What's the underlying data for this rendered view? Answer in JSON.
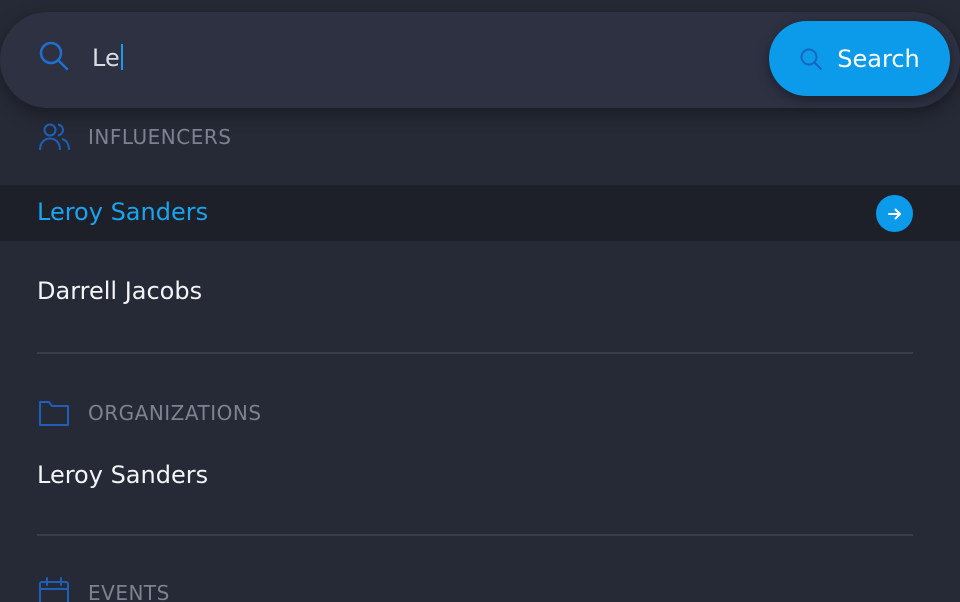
{
  "search": {
    "query": "Le",
    "button_label": "Search",
    "icon": "search-icon"
  },
  "sections": {
    "influencers": {
      "label": "INFLUENCERS",
      "icon": "users-icon",
      "items": [
        "Leroy Sanders",
        "Darrell Jacobs"
      ]
    },
    "organizations": {
      "label": "ORGANIZATIONS",
      "icon": "folder-icon",
      "items": [
        "Leroy Sanders"
      ]
    },
    "events": {
      "label": "EVENTS",
      "icon": "calendar-icon"
    }
  },
  "colors": {
    "background": "#262a36",
    "accent": "#0b9bea",
    "highlight_row": "#1d2029",
    "muted_text": "#7d8290"
  }
}
